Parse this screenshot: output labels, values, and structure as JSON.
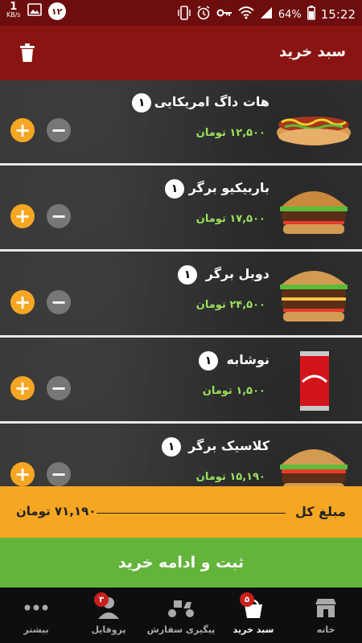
{
  "status_bar": {
    "speed_value": "1",
    "speed_unit": "KB/s",
    "notification_count": "۱۲",
    "battery": "64%",
    "time": "15:22"
  },
  "header": {
    "title": "سبد خرید",
    "trash_icon": "trash-icon"
  },
  "cart": {
    "items": [
      {
        "name": "هات داگ امریکایی",
        "qty": "۱",
        "price": "۱۲,۵۰۰ تومان",
        "image": "hotdog"
      },
      {
        "name": "باربیکیو برگر",
        "qty": "۱",
        "price": "۱۷,۵۰۰ تومان",
        "image": "burger"
      },
      {
        "name": "دوبل برگر",
        "qty": "۱",
        "price": "۲۴,۵۰۰ تومان",
        "image": "double-burger"
      },
      {
        "name": "نوشابه",
        "qty": "۱",
        "price": "۱,۵۰۰ تومان",
        "image": "cola-can"
      },
      {
        "name": "کلاسیک برگر",
        "qty": "۱",
        "price": "۱۵,۱۹۰ تومان",
        "image": "classic-burger"
      }
    ]
  },
  "total": {
    "label": "مبلغ کل",
    "amount": "۷۱,۱۹۰ تومان"
  },
  "checkout_label": "ثبت و ادامه خرید",
  "nav": {
    "items": [
      {
        "label": "خانه",
        "icon": "store-icon"
      },
      {
        "label": "سبد خرید",
        "icon": "cart-icon",
        "badge": "۵"
      },
      {
        "label": "پیگیری سفارش",
        "icon": "scooter-icon"
      },
      {
        "label": "پروفایل",
        "icon": "profile-icon",
        "badge": "۳"
      },
      {
        "label": "بیشتر",
        "icon": "more-icon"
      }
    ]
  },
  "colors": {
    "header": "#8a1411",
    "status_bar": "#6d0d0d",
    "accent_orange": "#f5a623",
    "checkout_green": "#63b43b",
    "price_green": "#9be15d"
  }
}
